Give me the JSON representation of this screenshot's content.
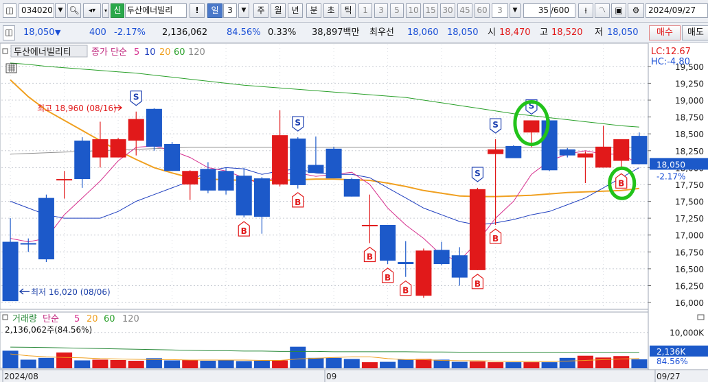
{
  "toolbar": {
    "code": "034020",
    "name": "두산에너빌리",
    "shin": "신",
    "excl": "!",
    "il": "일",
    "il_num": "3",
    "ju": "주",
    "wol": "월",
    "nyeon": "년",
    "bun": "분",
    "cho": "초",
    "tik": "틱",
    "periods": [
      "1",
      "3",
      "5",
      "10",
      "15",
      "30",
      "45",
      "60"
    ],
    "period_sel": "3",
    "count": "35",
    "count_total": "/600",
    "date": "2024/09/27"
  },
  "quote": {
    "price": "18,050",
    "arrow": "▼",
    "change": "400",
    "pct": "-2.17%",
    "volume": "2,136,062",
    "vol_ratio": "84.56%",
    "turnover": "0.33%",
    "amount": "38,897백만",
    "best_label": "최우선",
    "best_ask": "18,060",
    "best_bid": "18,050",
    "open_label": "시",
    "open": "18,470",
    "high_label": "고",
    "high": "18,520",
    "low_label": "저",
    "low": "18,050",
    "buy": "매수",
    "sell": "매도"
  },
  "chart_data": [
    {
      "type": "candlestick",
      "title": "두산에너빌리티",
      "legend": {
        "label": "종가 단순",
        "periods": [
          "5",
          "10",
          "20",
          "60",
          "120"
        ]
      },
      "y_ticks": [
        19500,
        19250,
        19000,
        18750,
        18500,
        18250,
        18000,
        17750,
        17500,
        17250,
        17000,
        16750,
        16500,
        16250,
        16000
      ],
      "ylim": [
        15950,
        19620
      ],
      "lc_label": "LC:12.67",
      "hc_label": "HC:-4.80",
      "current_price_label": "18,050",
      "current_pct_label": "-2.17%",
      "x_labels": [
        {
          "i": 0,
          "text": "2024/08"
        },
        {
          "i": 18,
          "text": "09"
        },
        {
          "i": 36,
          "text": "09/27"
        }
      ],
      "high_note": "최고 18,960 (08/16)",
      "low_note": "최저 16,020 (08/06)",
      "candles": [
        {
          "o": 16900,
          "h": 17250,
          "l": 16030,
          "c": 16020
        },
        {
          "o": 16880,
          "h": 16950,
          "l": 16750,
          "c": 16860
        },
        {
          "o": 17550,
          "h": 17600,
          "l": 16600,
          "c": 16640
        },
        {
          "o": 17820,
          "h": 17950,
          "l": 17540,
          "c": 17830
        },
        {
          "o": 18400,
          "h": 18450,
          "l": 17700,
          "c": 17830
        },
        {
          "o": 18150,
          "h": 18680,
          "l": 18000,
          "c": 18420
        },
        {
          "o": 18150,
          "h": 18440,
          "l": 18150,
          "c": 18420
        },
        {
          "o": 18400,
          "h": 18830,
          "l": 18180,
          "c": 18720
        },
        {
          "o": 18870,
          "h": 18880,
          "l": 18250,
          "c": 18310
        },
        {
          "o": 18350,
          "h": 18380,
          "l": 17950,
          "c": 17950
        },
        {
          "o": 17750,
          "h": 17960,
          "l": 17520,
          "c": 17950
        },
        {
          "o": 17980,
          "h": 18080,
          "l": 17620,
          "c": 17660
        },
        {
          "o": 17950,
          "h": 18000,
          "l": 17600,
          "c": 17660
        },
        {
          "o": 17880,
          "h": 18000,
          "l": 17260,
          "c": 17290
        },
        {
          "o": 17840,
          "h": 17860,
          "l": 17020,
          "c": 17270
        },
        {
          "o": 17750,
          "h": 18850,
          "l": 17720,
          "c": 18480
        },
        {
          "o": 18430,
          "h": 18450,
          "l": 17690,
          "c": 17740
        },
        {
          "o": 18040,
          "h": 18460,
          "l": 17950,
          "c": 17920
        },
        {
          "o": 18280,
          "h": 18310,
          "l": 17850,
          "c": 17840
        },
        {
          "o": 17830,
          "h": 17850,
          "l": 17570,
          "c": 17570
        },
        {
          "o": 17150,
          "h": 17600,
          "l": 16880,
          "c": 17150
        },
        {
          "o": 17150,
          "h": 17150,
          "l": 16570,
          "c": 16620
        },
        {
          "o": 16600,
          "h": 16910,
          "l": 16380,
          "c": 16570
        },
        {
          "o": 16100,
          "h": 16800,
          "l": 16070,
          "c": 16770
        },
        {
          "o": 16780,
          "h": 16900,
          "l": 16550,
          "c": 16570
        },
        {
          "o": 16700,
          "h": 16820,
          "l": 16250,
          "c": 16370
        },
        {
          "o": 16480,
          "h": 17700,
          "l": 16480,
          "c": 17680
        },
        {
          "o": 18200,
          "h": 18420,
          "l": 17150,
          "c": 18270
        },
        {
          "o": 18320,
          "h": 18330,
          "l": 18210,
          "c": 18140
        },
        {
          "o": 18520,
          "h": 18700,
          "l": 18300,
          "c": 18700
        },
        {
          "o": 18700,
          "h": 18720,
          "l": 17950,
          "c": 17960
        },
        {
          "o": 18270,
          "h": 18290,
          "l": 18150,
          "c": 18180
        },
        {
          "o": 18150,
          "h": 18240,
          "l": 17770,
          "c": 18210
        },
        {
          "o": 18000,
          "h": 18620,
          "l": 18000,
          "c": 18310
        },
        {
          "o": 18100,
          "h": 18390,
          "l": 17970,
          "c": 18420
        },
        {
          "o": 18470,
          "h": 18520,
          "l": 18050,
          "c": 18050
        }
      ],
      "ma5": [
        16950,
        16900,
        16950,
        17300,
        17550,
        17800,
        18100,
        18300,
        18320,
        18250,
        18150,
        18000,
        17950,
        17850,
        17750,
        17900,
        17920,
        17870,
        17900,
        17930,
        17750,
        17400,
        17150,
        16950,
        16700,
        16620,
        16900,
        17250,
        17500,
        17900,
        18100,
        18200,
        18250,
        18200,
        18200,
        18050
      ],
      "ma10": [
        17500,
        17400,
        17300,
        17250,
        17250,
        17250,
        17350,
        17500,
        17600,
        17700,
        17800,
        17950,
        18000,
        17980,
        17900,
        17950,
        17980,
        17920,
        17900,
        17900,
        17850,
        17700,
        17550,
        17400,
        17300,
        17200,
        17150,
        17180,
        17230,
        17300,
        17350,
        17450,
        17550,
        17700,
        17850,
        18000
      ],
      "ma20": [
        19300,
        19050,
        18850,
        18700,
        18550,
        18400,
        18250,
        18120,
        18000,
        17920,
        17850,
        17830,
        17820,
        17810,
        17810,
        17810,
        17820,
        17830,
        17830,
        17820,
        17810,
        17770,
        17720,
        17660,
        17620,
        17580,
        17570,
        17570,
        17580,
        17590,
        17610,
        17630,
        17640,
        17650,
        17660,
        17690
      ],
      "ma60": [
        19550,
        19530,
        19500,
        19480,
        19460,
        19440,
        19420,
        19400,
        19370,
        19340,
        19310,
        19280,
        19250,
        19220,
        19200,
        19180,
        19160,
        19140,
        19120,
        19100,
        19080,
        19060,
        19040,
        19000,
        18960,
        18920,
        18880,
        18840,
        18800,
        18770,
        18740,
        18710,
        18680,
        18650,
        18620,
        18600
      ],
      "ma120": [
        18200,
        18210,
        18220,
        18230,
        18240,
        18250,
        18260,
        18270,
        18280,
        18290,
        18300,
        18300,
        18300,
        18300,
        18300,
        18300,
        18300,
        18300,
        18300,
        18300,
        18300,
        18300,
        18300,
        18300,
        18300,
        18300,
        18300,
        18300,
        18300,
        18300,
        18300,
        18300,
        18300,
        18300,
        18300,
        18300
      ],
      "signals": [
        {
          "i": 7,
          "type": "S"
        },
        {
          "i": 16,
          "type": "S"
        },
        {
          "i": 26,
          "type": "S"
        },
        {
          "i": 27,
          "type": "S"
        },
        {
          "i": 29,
          "type": "S"
        },
        {
          "i": 13,
          "type": "B"
        },
        {
          "i": 16,
          "type": "B"
        },
        {
          "i": 20,
          "type": "B"
        },
        {
          "i": 21,
          "type": "B"
        },
        {
          "i": 22,
          "type": "B"
        },
        {
          "i": 26,
          "type": "B"
        },
        {
          "i": 27,
          "type": "B"
        },
        {
          "i": 34,
          "type": "B"
        }
      ],
      "circled": [
        29,
        34
      ]
    },
    {
      "type": "bar",
      "title": "거래량",
      "legend": {
        "label": "단순",
        "periods": [
          "5",
          "20",
          "60",
          "120"
        ]
      },
      "info": "2,136,062주(84.56%)",
      "tick_label": "10,000K",
      "ylim": [
        0,
        13000000
      ],
      "values": [
        4900000,
        2400000,
        2900000,
        4400000,
        2200000,
        2400000,
        2300000,
        2100000,
        2800000,
        2200000,
        2300000,
        2100000,
        2300000,
        2000000,
        2100000,
        2200000,
        6000000,
        2900000,
        2900000,
        2600000,
        1700000,
        1800000,
        2500000,
        2600000,
        2400000,
        1800000,
        1900000,
        1700000,
        1700000,
        1700000,
        1700000,
        2900000,
        3500000,
        3000000,
        3400000,
        2500000
      ],
      "ma": [
        4000000,
        3500000,
        3200000,
        3000000,
        2900000,
        2700000,
        2600000,
        2500000,
        2400000,
        2400000,
        2300000,
        2300000,
        2300000,
        2300000,
        2200000,
        2200000,
        2600000,
        2800000,
        3000000,
        3200000,
        3200000,
        2700000,
        2400000,
        2400000,
        2200000,
        2100000,
        2100000,
        2000000,
        1900000,
        1900000,
        1900000,
        2000000,
        2200000,
        2400000,
        2600000,
        2700000
      ],
      "ma_b": [
        5900000,
        5850000,
        5800000,
        5700000,
        5600000,
        5500000,
        5400000,
        5300000,
        5200000,
        5100000,
        5000000,
        4900000,
        4900000,
        4800000,
        4800000,
        4700000,
        4700000,
        4700000,
        4600000,
        4600000,
        4600000,
        4600000,
        4600000,
        4550000,
        4550000,
        4500000,
        4500000,
        4500000,
        4500000,
        4500000,
        4500000,
        4450000,
        4450000,
        4450000,
        4450000,
        4450000
      ],
      "current_label": "2,136K",
      "current_pct": "84.56%"
    }
  ]
}
